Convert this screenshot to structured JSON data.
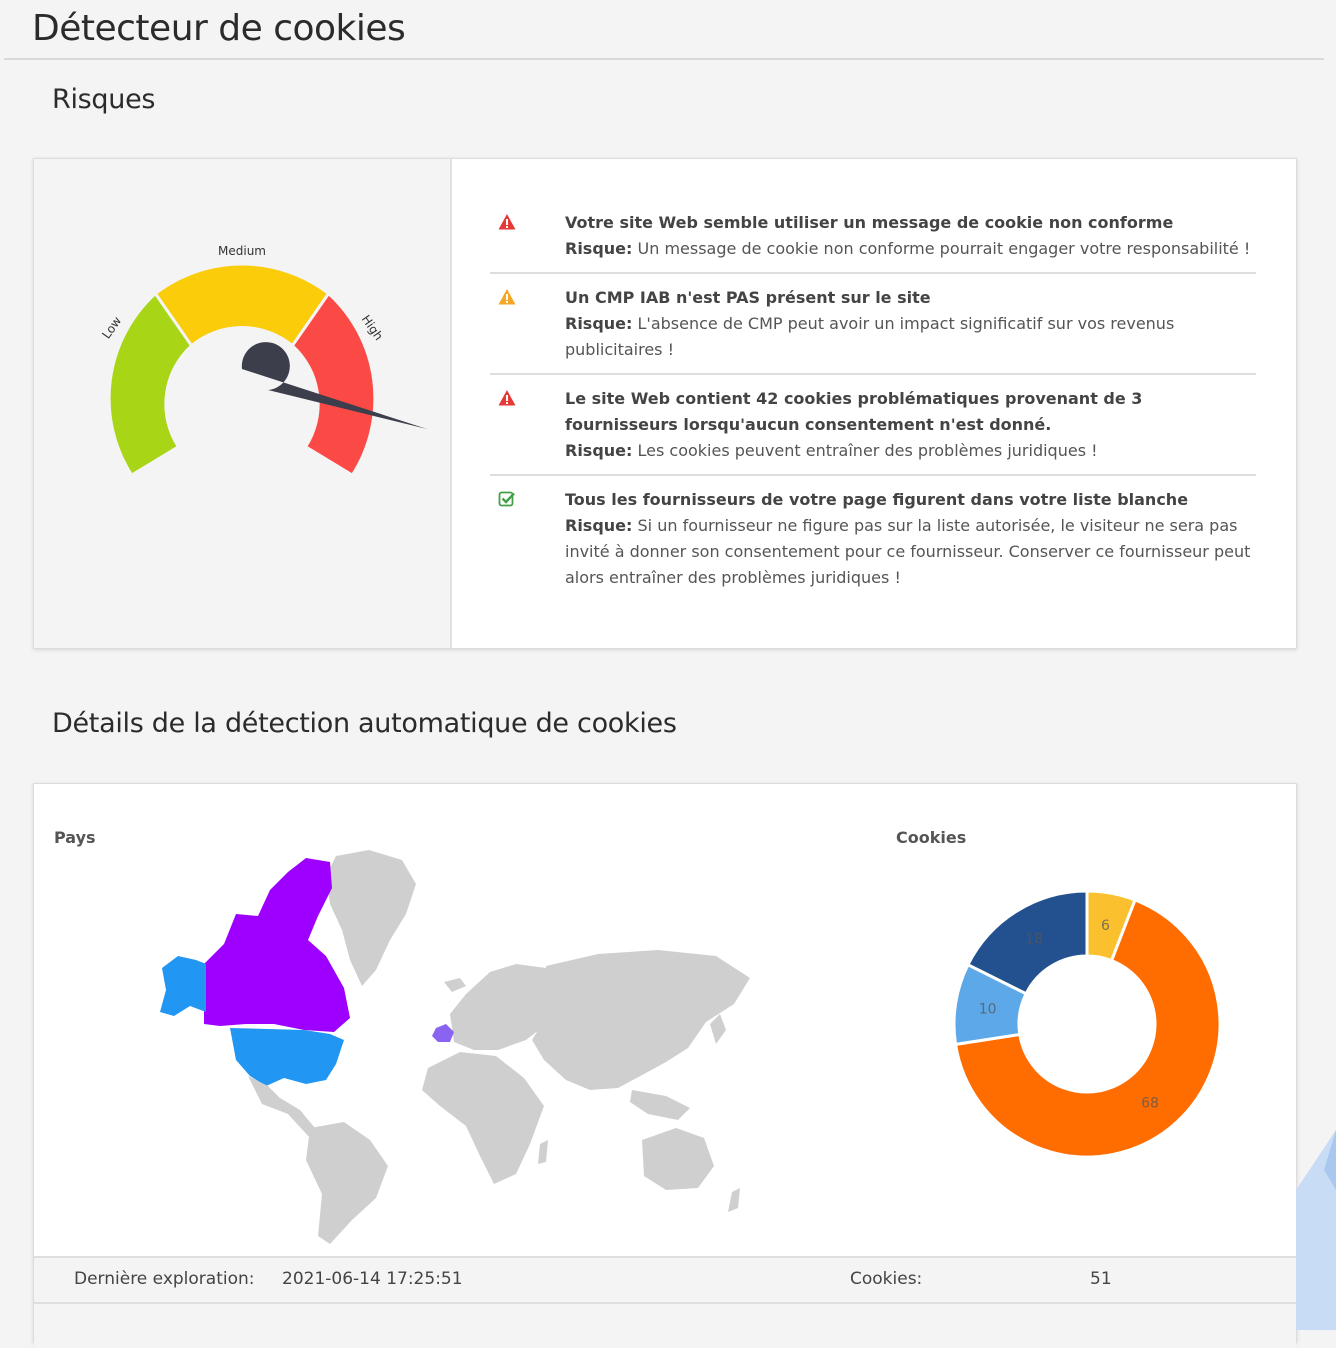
{
  "page": {
    "title": "Détecteur de cookies"
  },
  "risk_section": {
    "title": "Risques",
    "gauge": {
      "labels": {
        "low": "Low",
        "medium": "Medium",
        "high": "High"
      },
      "level": "High"
    },
    "items": [
      {
        "status": "danger",
        "icon": "warning-red-icon",
        "title": "Votre site Web semble utiliser un message de cookie non conforme",
        "risk_label": "Risque:",
        "risk_text": "Un message de cookie non conforme pourrait engager votre responsabilité !"
      },
      {
        "status": "warning",
        "icon": "warning-orange-icon",
        "title": "Un CMP IAB n'est PAS présent sur le site",
        "risk_label": "Risque:",
        "risk_text": "L'absence de CMP peut avoir un impact significatif sur vos revenus publicitaires !"
      },
      {
        "status": "danger",
        "icon": "warning-red-icon",
        "title": "Le site Web contient 42 cookies problématiques provenant de 3 fournisseurs lorsqu'aucun consentement n'est donné.",
        "risk_label": "Risque:",
        "risk_text": "Les cookies peuvent entraîner des problèmes juridiques !"
      },
      {
        "status": "ok",
        "icon": "check-green-icon",
        "title": "Tous les fournisseurs de votre page figurent dans votre liste blanche",
        "risk_label": "Risque:",
        "risk_text": "Si un fournisseur ne figure pas sur la liste autorisée, le visiteur ne sera pas invité à donner son consentement pour ce fournisseur. Conserver ce fournisseur peut alors entraîner des problèmes juridiques !"
      }
    ]
  },
  "details_section": {
    "title": "Détails de la détection automatique de cookies",
    "map_label": "Pays",
    "donut_label": "Cookies",
    "info_rows": [
      {
        "label": "Dernière exploration:",
        "value": "2021-06-14 17:25:51",
        "label2": "Cookies:",
        "value2": "51"
      }
    ]
  },
  "chart_data": {
    "type": "pie",
    "title": "Cookies",
    "categories": [
      "",
      "",
      "",
      ""
    ],
    "values": [
      6,
      68,
      10,
      18
    ],
    "colors": [
      "#fbc02d",
      "#ff6d00",
      "#5ca8e8",
      "#23508f"
    ]
  },
  "colors": {
    "gauge_low": "#a8d515",
    "gauge_medium": "#fbcc09",
    "gauge_high": "#fb4a46",
    "needle": "#3d3e4c",
    "map_canada": "#9d00ff",
    "map_usa": "#2196f3",
    "map_france": "#8a63f0",
    "map_other": "#cfcfcf"
  }
}
